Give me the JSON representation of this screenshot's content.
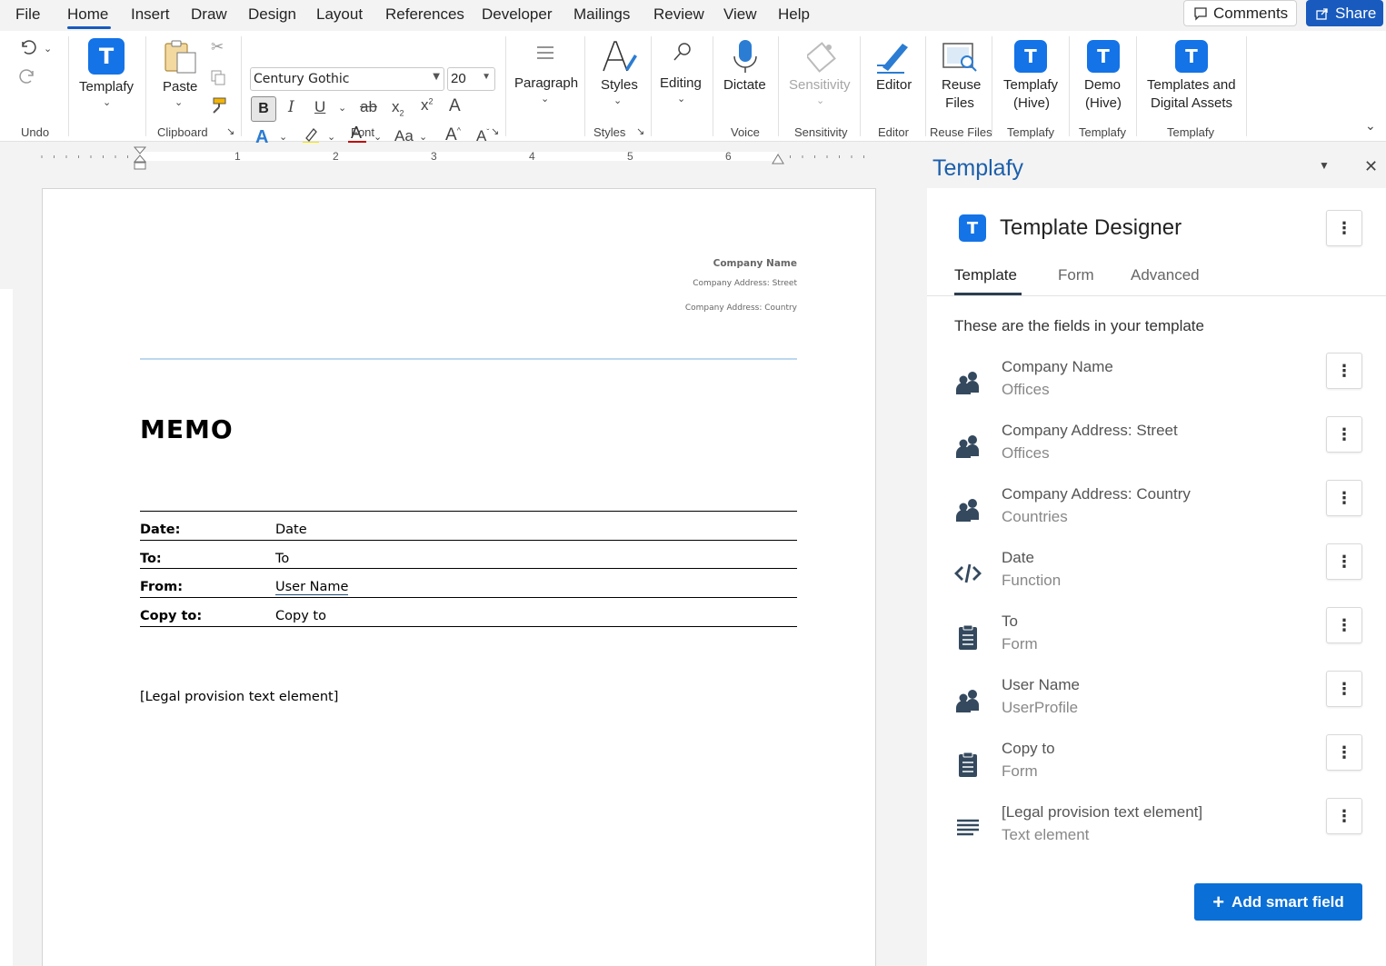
{
  "menu": {
    "items": [
      "File",
      "Home",
      "Insert",
      "Draw",
      "Design",
      "Layout",
      "References",
      "Developer",
      "Mailings",
      "Review",
      "View",
      "Help"
    ],
    "active": "Home",
    "comments_label": "Comments",
    "share_label": "Share"
  },
  "ribbon": {
    "undo_group": "Undo",
    "templafy_button": "Templafy",
    "paste_label": "Paste",
    "clipboard_group": "Clipboard",
    "font_name": "Century Gothic",
    "font_size": "20",
    "font_group": "Font",
    "paragraph_label": "Paragraph",
    "styles_label": "Styles",
    "styles_group": "Styles",
    "editing_label": "Editing",
    "dictate_label": "Dictate",
    "voice_group": "Voice",
    "sensitivity_label": "Sensitivity",
    "sensitivity_group": "Sensitivity",
    "editor_label": "Editor",
    "editor_group": "Editor",
    "reuse_files_label_1": "Reuse",
    "reuse_files_label_2": "Files",
    "reuse_files_group": "Reuse Files",
    "templafy_hive_1": "Templafy",
    "templafy_hive_2": "(Hive)",
    "templafy_group_1": "Templafy",
    "demo_hive_1": "Demo",
    "demo_hive_2": "(Hive)",
    "templafy_group_2": "Templafy",
    "templates_assets_1": "Templates and",
    "templates_assets_2": "Digital Assets",
    "templafy_group_3": "Templafy"
  },
  "ruler": {
    "numbers": [
      "1",
      "2",
      "3",
      "4",
      "5",
      "6"
    ]
  },
  "document": {
    "company_name": "Company Name",
    "company_street": "Company Address: Street",
    "company_country": "Company Address: Country",
    "title": "MEMO",
    "rows": [
      {
        "label": "Date:",
        "value": "Date"
      },
      {
        "label": "To:",
        "value": "To"
      },
      {
        "label": "From:",
        "value": "User Name"
      },
      {
        "label": "Copy to:",
        "value": "Copy to"
      }
    ],
    "legal": "[Legal provision text element]"
  },
  "panel": {
    "title": "Templafy",
    "designer_title": "Template Designer",
    "tabs": [
      "Template",
      "Form",
      "Advanced"
    ],
    "active_tab": "Template",
    "heading": "These are the fields in your template",
    "fields": [
      {
        "name": "Company Name",
        "type": "Offices",
        "icon": "people-icon"
      },
      {
        "name": "Company Address: Street",
        "type": "Offices",
        "icon": "people-icon"
      },
      {
        "name": "Company Address: Country",
        "type": "Countries",
        "icon": "people-icon"
      },
      {
        "name": "Date",
        "type": "Function",
        "icon": "code-icon"
      },
      {
        "name": "To",
        "type": "Form",
        "icon": "clipboard-icon"
      },
      {
        "name": "User Name",
        "type": "UserProfile",
        "icon": "people-icon"
      },
      {
        "name": "Copy to",
        "type": "Form",
        "icon": "clipboard-icon"
      },
      {
        "name": "[Legal provision text element]",
        "type": "Text element",
        "icon": "text-lines-icon"
      }
    ],
    "add_button": "Add smart field"
  },
  "colors": {
    "accent": "#185abd",
    "templafy_blue": "#1473e6",
    "panel_title": "#1c5fab",
    "add_button": "#0a6fd6"
  }
}
